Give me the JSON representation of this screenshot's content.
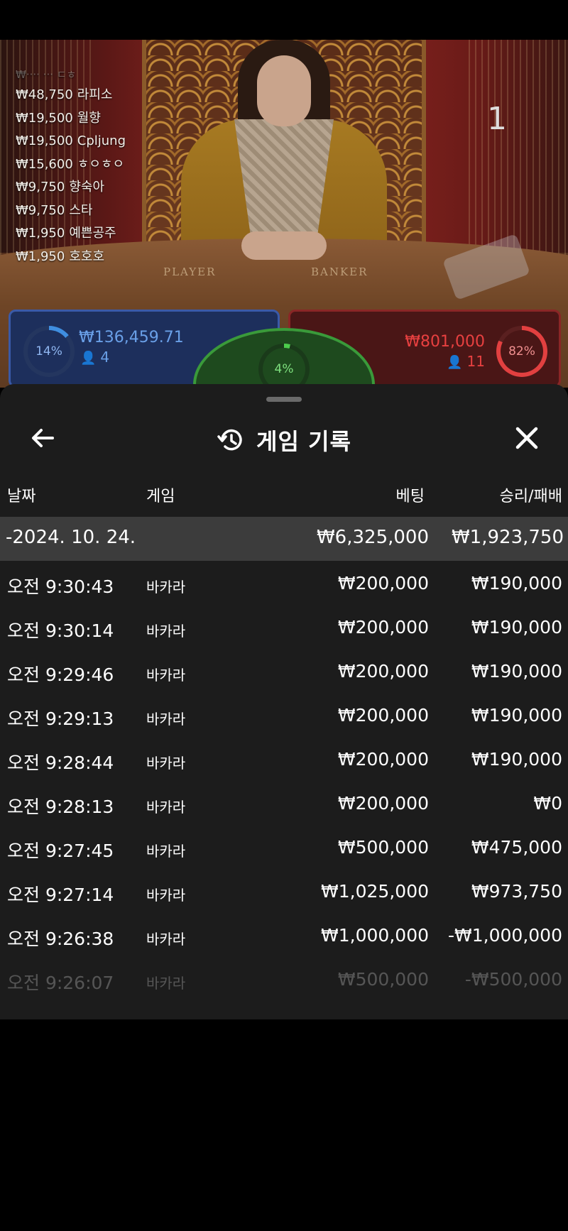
{
  "video": {
    "round_mark": "1",
    "table_labels": {
      "player": "PLAYER",
      "banker": "BANKER"
    },
    "leaderboard": [
      {
        "amount": "₩48,750",
        "name": "라피소"
      },
      {
        "amount": "₩19,500",
        "name": "월향"
      },
      {
        "amount": "₩19,500",
        "name": "Cpljung"
      },
      {
        "amount": "₩15,600",
        "name": "ㅎㅇㅎㅇ"
      },
      {
        "amount": "₩9,750",
        "name": "향숙아"
      },
      {
        "amount": "₩9,750",
        "name": "스타"
      },
      {
        "amount": "₩1,950",
        "name": "예쁜공주"
      },
      {
        "amount": "₩1,950",
        "name": "호호호"
      }
    ],
    "player_bet": {
      "percent": "14%",
      "amount": "₩136,459.71",
      "count": "4",
      "color": "#3f8ee0"
    },
    "banker_bet": {
      "percent": "82%",
      "amount": "₩801,000",
      "count": "11",
      "color": "#e24040"
    },
    "tie_bet": {
      "percent": "4%",
      "color": "#4ccc4c"
    }
  },
  "history": {
    "title": "게임 기록",
    "icons": {
      "back": "arrow-left-icon",
      "history": "history-icon",
      "close": "close-icon"
    },
    "columns": {
      "date": "날짜",
      "game": "게임",
      "bet": "베팅",
      "win_loss": "승리/패배"
    },
    "summary": {
      "date": "-2024. 10. 24.",
      "bet": "₩6,325,000",
      "win_loss": "₩1,923,750"
    },
    "rows": [
      {
        "time": "오전 9:30:43",
        "game": "바카라",
        "bet": "₩200,000",
        "win_loss": "₩190,000"
      },
      {
        "time": "오전 9:30:14",
        "game": "바카라",
        "bet": "₩200,000",
        "win_loss": "₩190,000"
      },
      {
        "time": "오전 9:29:46",
        "game": "바카라",
        "bet": "₩200,000",
        "win_loss": "₩190,000"
      },
      {
        "time": "오전 9:29:13",
        "game": "바카라",
        "bet": "₩200,000",
        "win_loss": "₩190,000"
      },
      {
        "time": "오전 9:28:44",
        "game": "바카라",
        "bet": "₩200,000",
        "win_loss": "₩190,000"
      },
      {
        "time": "오전 9:28:13",
        "game": "바카라",
        "bet": "₩200,000",
        "win_loss": "₩0"
      },
      {
        "time": "오전 9:27:45",
        "game": "바카라",
        "bet": "₩500,000",
        "win_loss": "₩475,000"
      },
      {
        "time": "오전 9:27:14",
        "game": "바카라",
        "bet": "₩1,025,000",
        "win_loss": "₩973,750"
      },
      {
        "time": "오전 9:26:38",
        "game": "바카라",
        "bet": "₩1,000,000",
        "win_loss": "-₩1,000,000"
      },
      {
        "time": "오전 9:26:07",
        "game": "바카라",
        "bet": "₩500,000",
        "win_loss": "-₩500,000"
      }
    ]
  }
}
